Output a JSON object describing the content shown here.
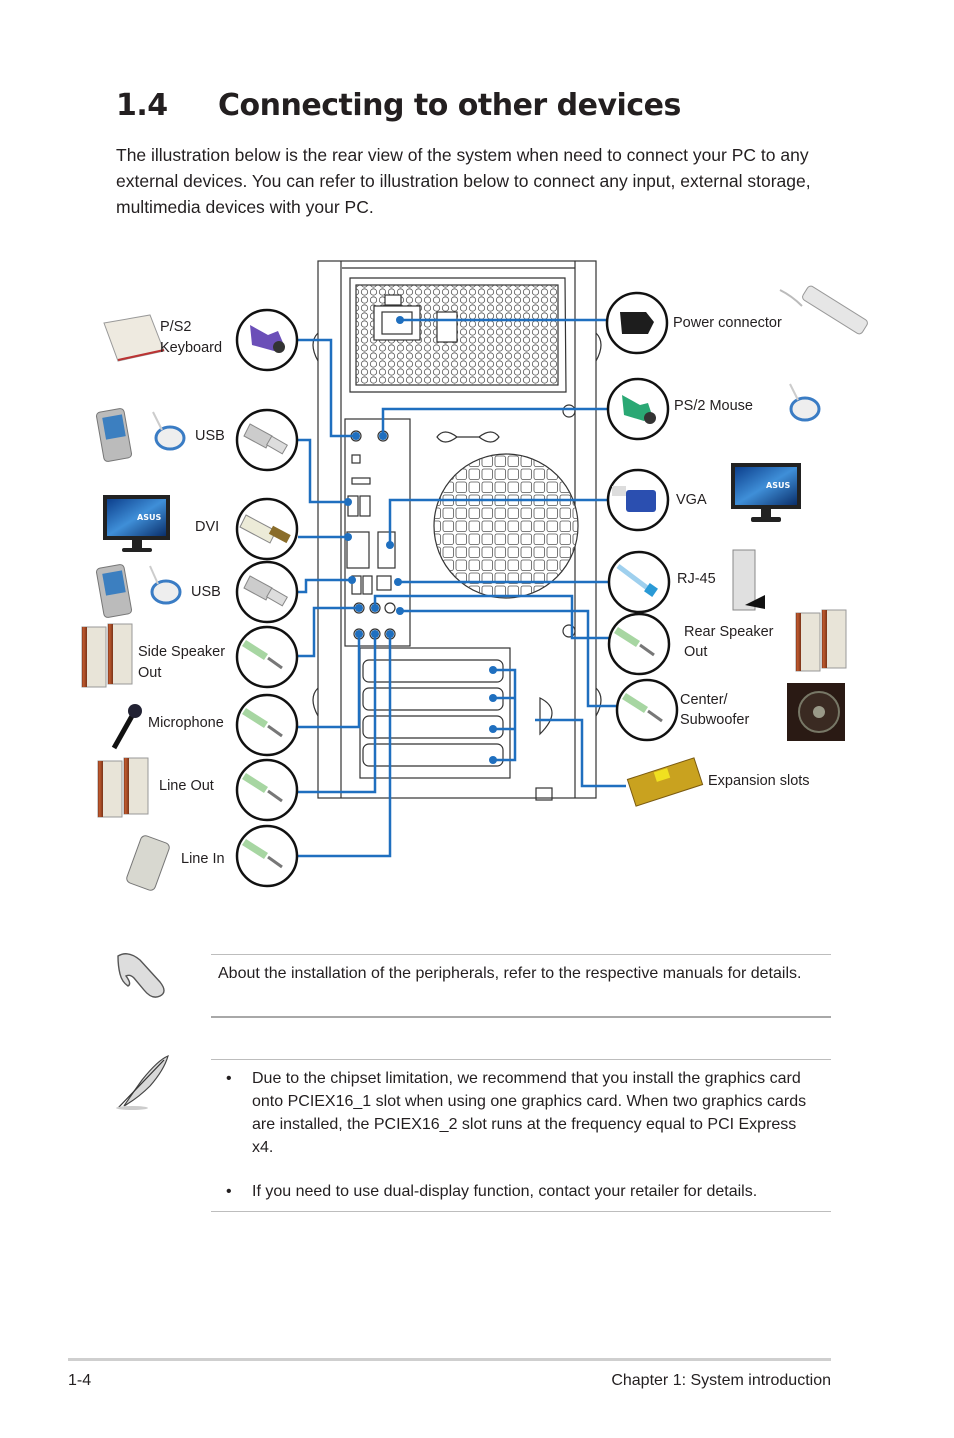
{
  "section": {
    "number": "1.4",
    "title": "Connecting to other devices",
    "intro": "The illustration below is the rear view of the system when need to connect your PC to any external devices. You can refer to illustration below to connect any input, external storage, multimedia devices with your PC."
  },
  "diagram": {
    "line_color": "#1f6fbf",
    "left_labels": {
      "ps2_keyboard_1": "P/S2",
      "ps2_keyboard_2": "Keyboard",
      "usb_top": "USB",
      "dvi": "DVI",
      "usb_bottom": "USB",
      "side_speaker_1": "Side Speaker",
      "side_speaker_2": "Out",
      "microphone": "Microphone",
      "line_out": "Line Out",
      "line_in": "Line In"
    },
    "right_labels": {
      "power": "Power connector",
      "ps2_mouse": "PS/2 Mouse",
      "vga": "VGA",
      "rj45": "RJ-45",
      "rear_speaker_1": "Rear Speaker",
      "rear_speaker_2": "Out",
      "center_1": "Center/",
      "center_2": "Subwoofer",
      "expansion": "Expansion slots"
    },
    "monitor_brand": "ASUS"
  },
  "notes": {
    "caution": "About the installation of the peripherals, refer to the respective manuals for details.",
    "bullet_symbol": "•",
    "bullets": [
      "Due to the chipset limitation, we recommend that you install the graphics card onto PCIEX16_1 slot when using one graphics card. When two graphics cards are installed, the PCIEX16_2 slot runs at the frequency equal to PCI Express x4.",
      "If you need to use dual-display function, contact your retailer for details."
    ]
  },
  "footer": {
    "page": "1-4",
    "chapter": "Chapter 1: System introduction"
  }
}
